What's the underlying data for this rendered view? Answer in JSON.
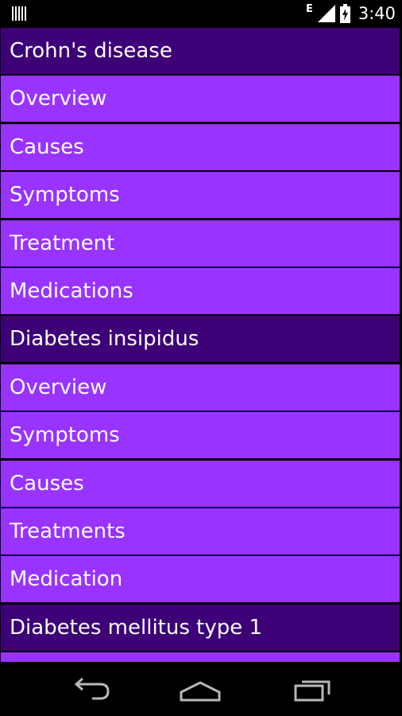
{
  "status_bar": {
    "network_type": "E",
    "time": "3:40",
    "icons": [
      "barcode-icon",
      "signal-icon",
      "battery-icon"
    ]
  },
  "list": {
    "rows": [
      {
        "type": "header",
        "label": "Crohn's disease"
      },
      {
        "type": "item",
        "label": "Overview"
      },
      {
        "type": "item",
        "label": "Causes"
      },
      {
        "type": "item",
        "label": "Symptoms"
      },
      {
        "type": "item",
        "label": "Treatment"
      },
      {
        "type": "item",
        "label": "Medications"
      },
      {
        "type": "header",
        "label": "Diabetes insipidus"
      },
      {
        "type": "item",
        "label": "Overview"
      },
      {
        "type": "item",
        "label": "Symptoms"
      },
      {
        "type": "item",
        "label": "Causes"
      },
      {
        "type": "item",
        "label": "Treatments"
      },
      {
        "type": "item",
        "label": "Medication"
      },
      {
        "type": "header",
        "label": "Diabetes mellitus type 1"
      },
      {
        "type": "item",
        "label": ""
      }
    ]
  },
  "nav_bar": {
    "buttons": [
      "back-icon",
      "home-icon",
      "recent-apps-icon"
    ]
  },
  "colors": {
    "header_bg": "#3d0077",
    "item_bg": "#9933ff",
    "text": "#ffffff",
    "divider": "#000000"
  }
}
